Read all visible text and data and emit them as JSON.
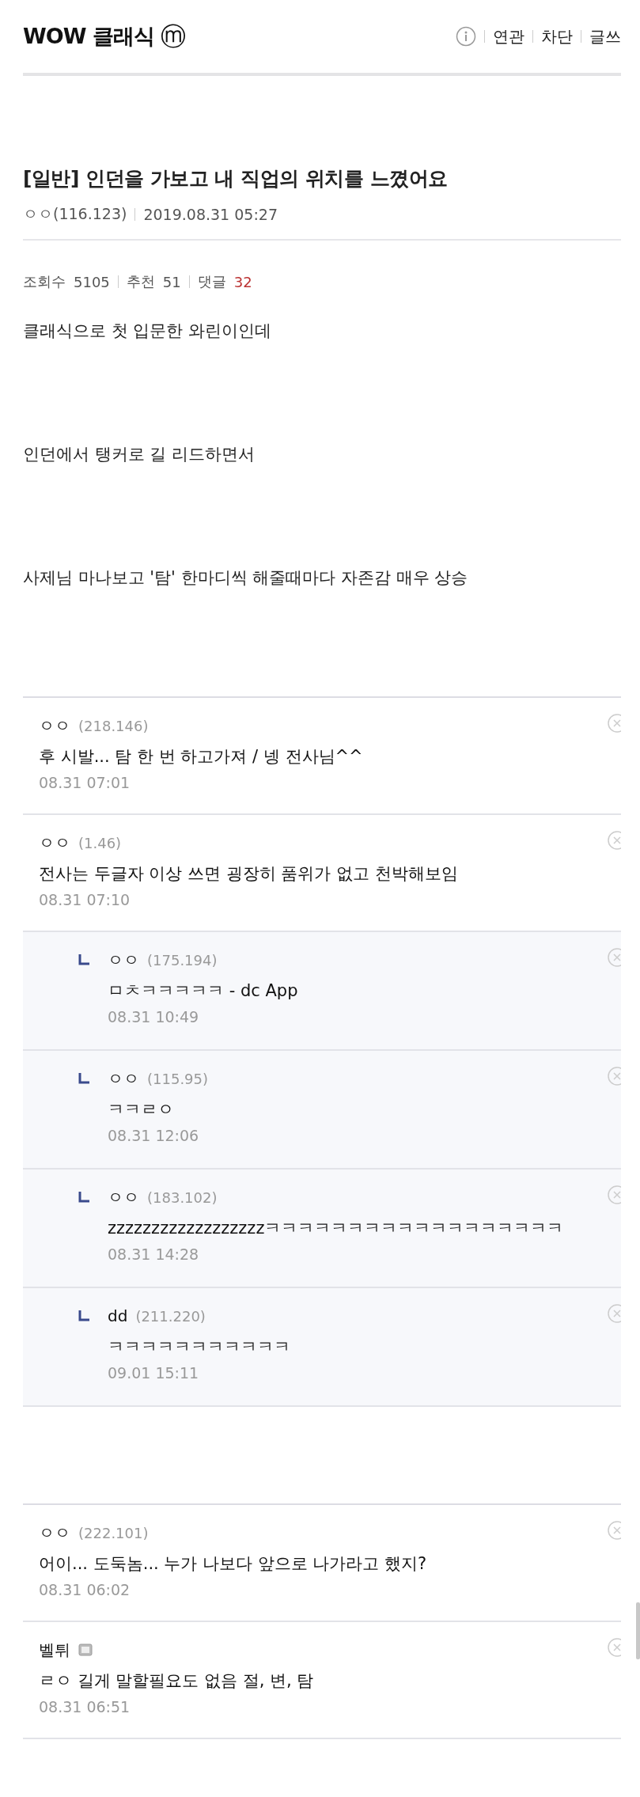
{
  "header": {
    "title": "WOW 클래식",
    "mobile_mark": "ⓜ",
    "links": [
      "연관",
      "차단",
      "글쓰"
    ]
  },
  "post": {
    "title": "[일반] 인던을 가보고 내 직업의 위치를 느꼈어요",
    "author": "ㅇㅇ(116.123)",
    "date": "2019.08.31 05:27",
    "stats": [
      {
        "label": "조회수",
        "value": "5105",
        "highlight": false
      },
      {
        "label": "추천",
        "value": "51",
        "highlight": false
      },
      {
        "label": "댓글",
        "value": "32",
        "highlight": true
      }
    ],
    "body": [
      "클래식으로 첫 입문한 와린이인데",
      "인던에서 탱커로 길 리드하면서",
      "사제님 마나보고 '탐' 한마디씩 해줄때마다 자존감 매우 상승"
    ]
  },
  "comments": [
    {
      "name": "ㅇㅇ",
      "ip": "(218.146)",
      "text": "후 시발... 탐 한 번 하고가져 / 넹 전사님^^",
      "date": "08.31 07:01"
    },
    {
      "name": "ㅇㅇ",
      "ip": "(1.46)",
      "text": "전사는 두글자 이상 쓰면 굉장히 품위가 없고 천박해보임",
      "date": "08.31 07:10",
      "replies": [
        {
          "name": "ㅇㅇ",
          "ip": "(175.194)",
          "text": "ㅁㅊㅋㅋㅋㅋㅋ - dc App",
          "date": "08.31 10:49"
        },
        {
          "name": "ㅇㅇ",
          "ip": "(115.95)",
          "text": "ㅋㅋㄹㅇ",
          "date": "08.31 12:06"
        },
        {
          "name": "ㅇㅇ",
          "ip": "(183.102)",
          "text": "zzzzzzzzzzzzzzzzzzㅋㅋㅋㅋㅋㅋㅋㅋㅋㅋㅋㅋㅋㅋㅋㅋㅋㅋ",
          "date": "08.31 14:28"
        },
        {
          "name": "dd",
          "ip": "(211.220)",
          "text": "ㅋㅋㅋㅋㅋㅋㅋㅋㅋㅋㅋ",
          "date": "09.01 15:11"
        }
      ]
    }
  ],
  "more_comments": [
    {
      "name": "ㅇㅇ",
      "ip": "(222.101)",
      "text": "어이... 도둑놈... 누가 나보다 앞으로 나가라고 했지?",
      "date": "08.31 06:02",
      "nick_icon": false
    },
    {
      "name": "벨튀",
      "text": "ㄹㅇ 길게 말할필요도 없음 절, 변, 탐",
      "date": "08.31 06:51",
      "nick_icon": true
    }
  ]
}
